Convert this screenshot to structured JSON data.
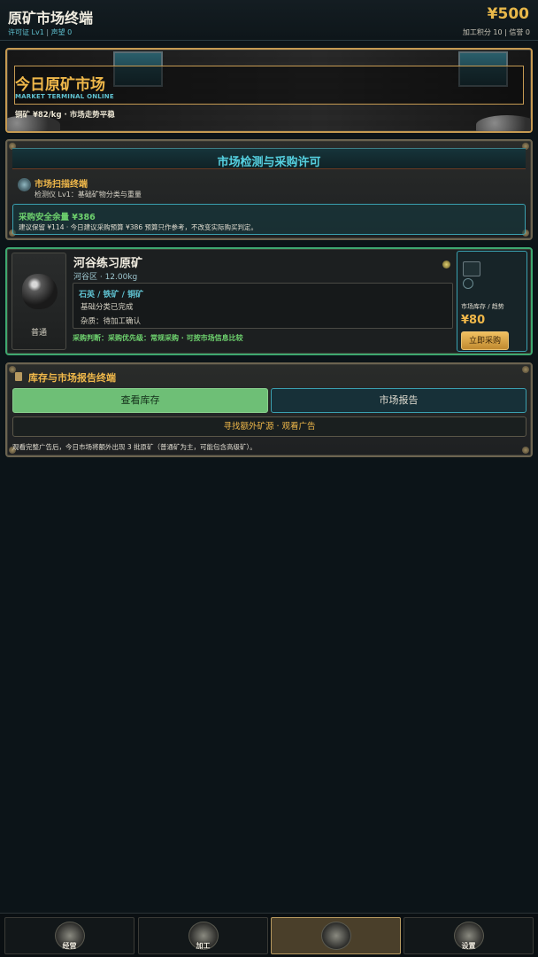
{
  "header": {
    "title": "原矿市场终端",
    "license": "许可证 Lv1",
    "reputation": "声望 0",
    "money": "¥500",
    "processing_points": "加工积分 10",
    "credit": "信誉 0"
  },
  "hero": {
    "title": "今日原矿市场",
    "subtitle": "MARKET TERMINAL ONLINE",
    "info": "铜矿 ¥82/kg  ·  市场走势平稳"
  },
  "detection": {
    "title": "市场检测与采购许可",
    "scanner_title": "市场扫描终端",
    "scanner_desc": "检测仪 Lv1：基础矿物分类与重量",
    "safe_title": "采购安全余量 ¥386",
    "safe_desc": "建议保留 ¥114 · 今日建议采购预算 ¥386 预算只作参考，不改变实际购买判定。"
  },
  "ore": {
    "grade": "普通",
    "name": "河谷练习原矿",
    "origin": "河谷区  ·  12.00kg",
    "types": "石英 / 铁矿 / 铜矿",
    "status": "基础分类已完成",
    "impurity": "杂质：待加工确认",
    "judgement": "采购判断：采购优先级：常规采购 · 可按市场信息比较",
    "stock_label": "市场库存 / 趋势",
    "price": "¥80",
    "buy_label": "立即采购"
  },
  "storage": {
    "title": "库存与市场报告终端",
    "inventory_label": "查看库存",
    "report_label": "市场报告",
    "ad_label": "寻找额外矿源 · 观看广告",
    "ad_note": "观看完整广告后，今日市场将额外出现 3 批原矿（普通矿为主，可能包含高级矿）。"
  },
  "nav": {
    "tabs": [
      {
        "label": "经营",
        "icon": "briefcase-emblem-icon"
      },
      {
        "label": "加工",
        "icon": "anvil-emblem-icon"
      },
      {
        "label": "",
        "icon": "ore-emblem-icon"
      },
      {
        "label": "设置",
        "icon": "gear-emblem-icon"
      }
    ]
  },
  "colors": {
    "accent_gold": "#f0b84a",
    "accent_cyan": "#5fc1d0",
    "accent_green": "#6ed26e",
    "background": "#0c1418"
  }
}
